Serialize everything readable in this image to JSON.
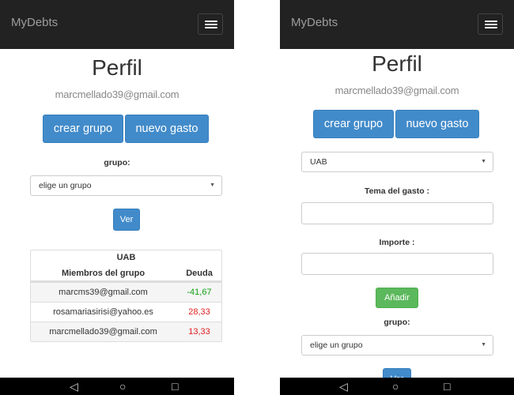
{
  "left": {
    "brand": "MyDebts",
    "title": "Perfil",
    "email": "marcmellado39@gmail.com",
    "btn_create": "crear grupo",
    "btn_expense": "nuevo gasto",
    "group_label": "grupo:",
    "group_select": "elige un grupo",
    "btn_view": "Ver",
    "table": {
      "caption": "UAB",
      "col_members": "Miembros del grupo",
      "col_debt": "Deuda",
      "rows": [
        {
          "member": "marcms39@gmail.com",
          "debt": "-41,67"
        },
        {
          "member": "rosamariasirisi@yahoo.es",
          "debt": "28,33"
        },
        {
          "member": "marcmellado39@gmail.com",
          "debt": "13,33"
        }
      ]
    }
  },
  "right": {
    "brand": "MyDebts",
    "title": "Perfil",
    "email": "marcmellado39@gmail.com",
    "btn_create": "crear grupo",
    "btn_expense": "nuevo gasto",
    "group_select_top": "UAB",
    "topic_label": "Tema del gasto :",
    "amount_label": "Importe :",
    "btn_add": "Añadir",
    "group_label": "grupo:",
    "group_select": "elige un grupo",
    "btn_view_partial": "Ver"
  },
  "system_nav": {
    "back_icon": "◁",
    "home_icon": "○",
    "recents_icon": "□"
  },
  "colors": {
    "navbar": "#222222",
    "primary": "#428bca",
    "success": "#5cb85c",
    "debt_positive": "#e02020",
    "debt_negative": "#10a010"
  }
}
